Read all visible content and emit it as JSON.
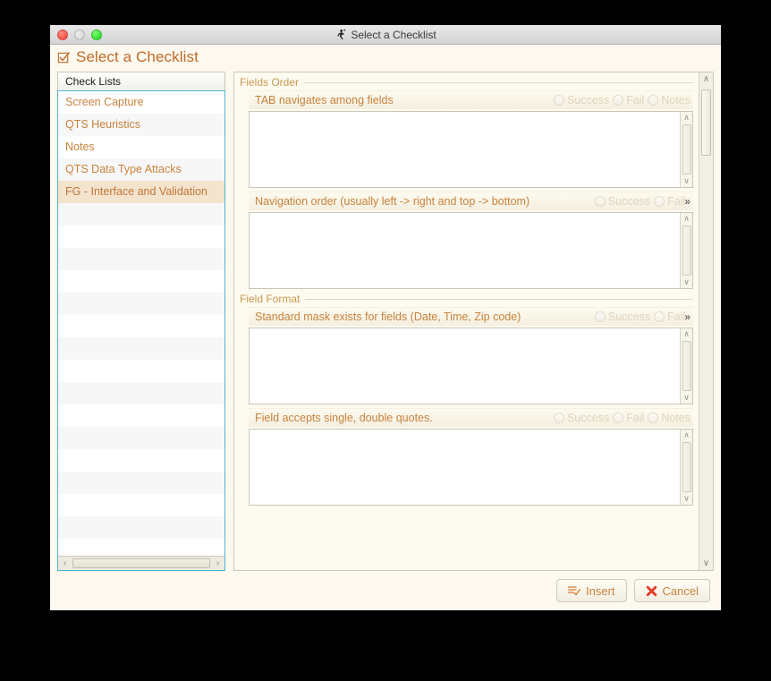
{
  "window": {
    "titlebar_title": "Select a Checklist",
    "titlebar_icon": "runner-icon",
    "traffic_lights": [
      "close-red",
      "minimize-grey",
      "zoom-green"
    ]
  },
  "header": {
    "icon": "checked-checkbox-icon",
    "title": "Select a Checklist"
  },
  "sidebar": {
    "column_header": "Check Lists",
    "items": [
      {
        "label": "Screen Capture",
        "selected": false
      },
      {
        "label": "QTS Heuristics",
        "selected": false
      },
      {
        "label": "Notes",
        "selected": false
      },
      {
        "label": "QTS Data Type Attacks",
        "selected": false
      },
      {
        "label": "FG - Interface and Validation",
        "selected": true
      }
    ],
    "empty_row_count": 16,
    "hscroll": {
      "left_arrow": "‹",
      "right_arrow": "›"
    }
  },
  "main": {
    "groups": [
      {
        "title": "Fields Order",
        "items": [
          {
            "label": "TAB navigates among fields",
            "options": [
              "Success",
              "Fail",
              "Notes"
            ],
            "truncated": false,
            "notes_value": "",
            "notes_placeholder": ""
          },
          {
            "label": "Navigation order (usually left -> right and top -> bottom)",
            "options": [
              "Success",
              "Fail"
            ],
            "truncated": true,
            "overflow_marker": "»",
            "notes_value": "",
            "notes_placeholder": ""
          }
        ]
      },
      {
        "title": "Field Format",
        "items": [
          {
            "label": "Standard mask exists for fields (Date, Time, Zip code)",
            "options": [
              "Success",
              "Fail"
            ],
            "truncated": true,
            "overflow_marker": "»",
            "notes_value": "",
            "notes_placeholder": ""
          },
          {
            "label": "Field accepts single, double quotes.",
            "options": [
              "Success",
              "Fail",
              "Notes"
            ],
            "truncated": false,
            "notes_value": "",
            "notes_placeholder": ""
          }
        ]
      }
    ],
    "vscroll": {
      "up_arrow": "∧",
      "down_arrow": "∨"
    },
    "textarea_scroll": {
      "up_arrow": "∧",
      "down_arrow": "∨"
    }
  },
  "footer": {
    "insert_label": "Insert",
    "insert_icon": "list-check-icon",
    "cancel_label": "Cancel",
    "cancel_icon": "red-x-icon"
  },
  "colors": {
    "accent_orange": "#c7833e",
    "group_title": "#c79a4e",
    "selection_bg": "#f4e3cd",
    "window_bg": "#fdf9ee",
    "focus_border": "#4db6d2",
    "cancel_red": "#e8392a"
  }
}
